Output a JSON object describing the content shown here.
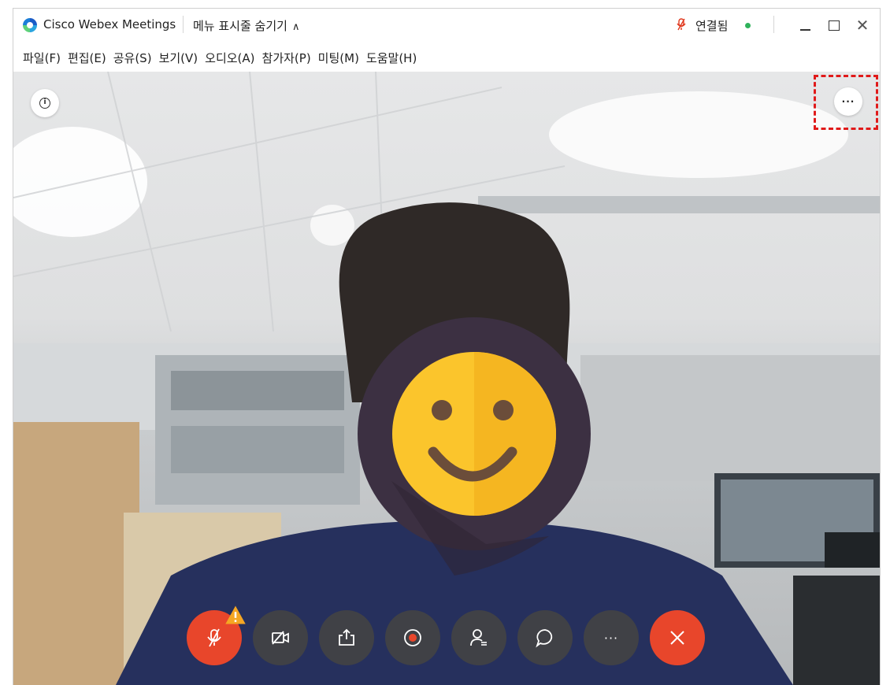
{
  "titlebar": {
    "app_name": "Cisco Webex Meetings",
    "hide_menu_label": "메뉴 표시줄 숨기기",
    "hide_menu_caret": "∧",
    "connection_status": "연결됨",
    "close_glyph": "✕"
  },
  "menu": {
    "items": [
      {
        "label": "파일(F)"
      },
      {
        "label": "편집(E)"
      },
      {
        "label": "공유(S)"
      },
      {
        "label": "보기(V)"
      },
      {
        "label": "오디오(A)"
      },
      {
        "label": "참가자(P)"
      },
      {
        "label": "미팅(M)"
      },
      {
        "label": "도움말(H)"
      }
    ]
  },
  "video": {
    "more_options_glyph": "···",
    "info_glyph": "i"
  },
  "controls": {
    "more_glyph": "···"
  },
  "colors": {
    "muted_mic": "#e8462b",
    "end_call": "#e8462b",
    "button_dark": "#404146",
    "connected": "#2fb25b",
    "highlight": "#e01a1a",
    "warning": "#f5a623"
  }
}
